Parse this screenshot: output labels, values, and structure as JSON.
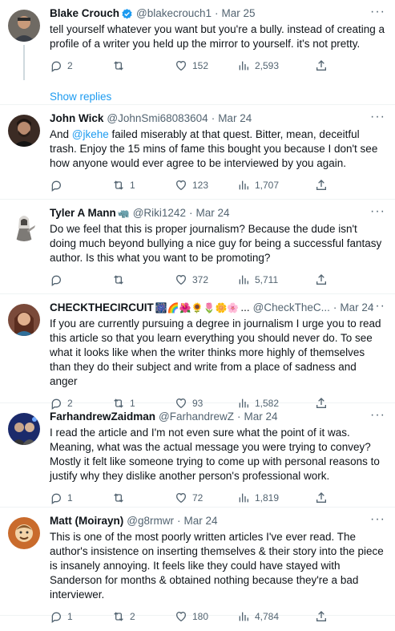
{
  "tweets": [
    {
      "name": "Blake Crouch",
      "handle": "@blakecrouch1",
      "time": "Mar 25",
      "verified": true,
      "text": "tell yourself whatever you want but you're a bully. instead of creating a profile of a writer you held up the mirror to yourself. it's not pretty.",
      "replies": "2",
      "retweets": "",
      "likes": "152",
      "views": "2,593"
    },
    {
      "name": "John Wick",
      "handle": "@JohnSmi68083604",
      "time": "Mar 24",
      "text_before": "And ",
      "mention": "@jkehe",
      "text_after": " failed miserably at that quest. Bitter, mean, deceitful trash. Enjoy the 15 mins of fame this bought you because I don't see how anyone would ever agree to be interviewed by you again.",
      "replies": "",
      "retweets": "1",
      "likes": "123",
      "views": "1,707"
    },
    {
      "name": "Tyler A Mann",
      "name_emoji": "🦏",
      "handle": "@Riki1242",
      "time": "Mar 24",
      "text": "Do we feel that this is proper journalism? Because the dude isn't doing much beyond bullying a nice guy for being a successful fantasy author. Is this what you want to be promoting?",
      "replies": "",
      "retweets": "",
      "likes": "372",
      "views": "5,711"
    },
    {
      "name": "CHECKTHECIRCUIT",
      "name_emoji": "🎆🌈🌺🌻🌷🌼🌸",
      "ellipsis": "...",
      "handle": "@CheckTheC...",
      "time": "Mar 24",
      "text": "If you are currently pursuing a degree in journalism I urge you to read this article so that you learn everything you should never do. To see what it looks like when the writer thinks more highly of themselves than they do their subject and write from a place of sadness and anger",
      "replies": "2",
      "retweets": "1",
      "likes": "93",
      "views": "1,582"
    },
    {
      "name": "FarhandrewZaidman",
      "handle": "@FarhandrewZ",
      "time": "Mar 24",
      "text": "I read the article and I'm not even sure what the point of it was. Meaning, what was the actual message you were trying to convey? Mostly it felt like someone trying to come up with personal reasons to justify why they dislike another person's professional work.",
      "replies": "1",
      "retweets": "",
      "likes": "72",
      "views": "1,819"
    },
    {
      "name": "Matt (Moirayn)",
      "handle": "@g8rmwr",
      "time": "Mar 24",
      "text": "This is one of the most poorly written articles I've ever read. The author's insistence on inserting themselves & their story into the piece is insanely annoying. It feels like they could have stayed with Sanderson for months & obtained nothing because they're a bad interviewer.",
      "replies": "1",
      "retweets": "2",
      "likes": "180",
      "views": "4,784"
    }
  ],
  "show_replies": "Show replies",
  "more_glyph": "···",
  "sep": "·",
  "colors": {
    "link": "#1d9bf0",
    "muted": "#536471",
    "text": "#0f1419",
    "border": "#eff3f4"
  },
  "icons": [
    "reply-icon",
    "retweet-icon",
    "like-icon",
    "views-icon",
    "share-icon",
    "verified-badge-icon",
    "more-icon"
  ]
}
